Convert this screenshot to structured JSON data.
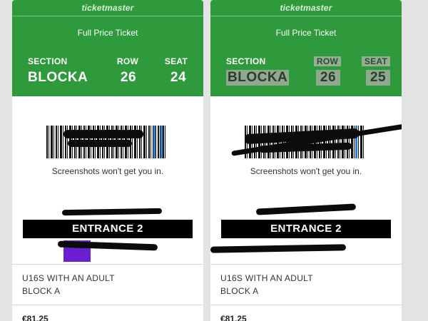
{
  "tickets": [
    {
      "brand": "ticketmaster",
      "type": "Full Price Ticket",
      "section_label": "SECTION",
      "row_label": "ROW",
      "seat_label": "SEAT",
      "section": "BLOCKA",
      "row": "26",
      "seat": "24",
      "barcode_caption": "Screenshots won't get you in.",
      "entrance": "ENTRANCE 2",
      "desc_line1": "U16S WITH AN ADULT",
      "desc_line2": "BLOCK A",
      "price": "€81.25"
    },
    {
      "brand": "ticketmaster",
      "type": "Full Price Ticket",
      "section_label": "SECTION",
      "row_label": "ROW",
      "seat_label": "SEAT",
      "section": "BLOCKA",
      "row": "26",
      "seat": "25",
      "barcode_caption": "Screenshots won't get you in.",
      "entrance": "ENTRANCE 2",
      "desc_line1": "U16S WITH AN ADULT",
      "desc_line2": "BLOCK A",
      "price": "€81.25"
    }
  ],
  "colors": {
    "header_green": "#2e9a3b",
    "entrance_bg": "#000000",
    "barcode_edge_blue": "#2f7fd1",
    "redaction_purple": "#6a1fd1"
  }
}
